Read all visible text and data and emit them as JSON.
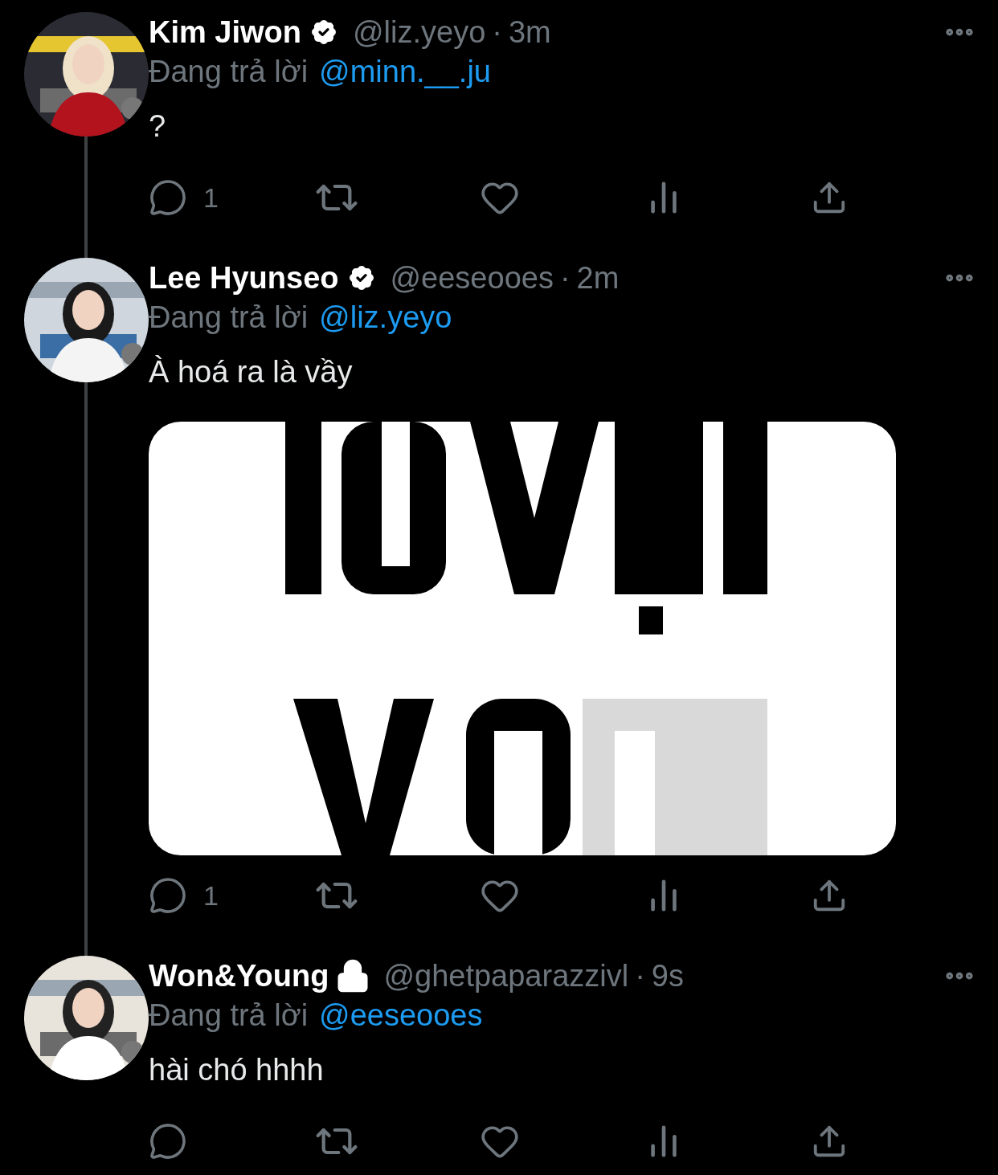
{
  "tweets": [
    {
      "name": "Kim Jiwon",
      "verified": true,
      "handle": "@liz.yeyo",
      "separator": "·",
      "time": "3m",
      "reply_label": "Đang trả lời",
      "reply_to": "@minn.__.ju",
      "text": "?",
      "reply_count": "1"
    },
    {
      "name": "Lee Hyunseo",
      "verified": true,
      "handle": "@eeseooes",
      "separator": "·",
      "time": "2m",
      "reply_label": "Đang trả lời",
      "reply_to": "@liz.yeyo",
      "text": "À hoá ra là vầy",
      "reply_count": "1"
    },
    {
      "name": "Won&Young",
      "protected": true,
      "handle": "@ghetpaparazzivl",
      "separator": "·",
      "time": "9s",
      "reply_label": "Đang trả lời",
      "reply_to": "@eeseooes",
      "text": "hài chó hhhh"
    }
  ]
}
